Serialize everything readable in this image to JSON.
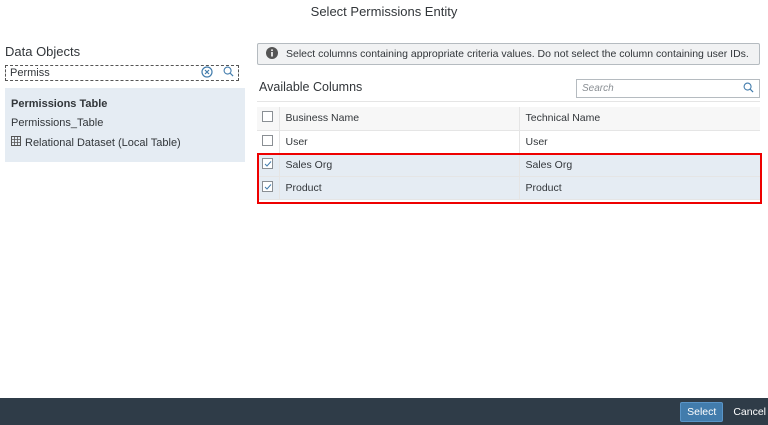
{
  "dialog": {
    "title": "Select Permissions Entity"
  },
  "left": {
    "heading": "Data Objects",
    "search_value": "Permiss",
    "result": {
      "title": "Permissions Table",
      "technical_name": "Permissions_Table",
      "type": "Relational Dataset (Local Table)",
      "type_icon": "table-icon"
    }
  },
  "info": {
    "icon": "info-icon",
    "message": "Select columns containing appropriate criteria values. Do not select the column containing user IDs."
  },
  "columns": {
    "heading": "Available Columns",
    "search_placeholder": "Search",
    "headers": [
      "Business Name",
      "Technical Name"
    ],
    "rows": [
      {
        "business": "User",
        "technical": "User",
        "checked": false
      },
      {
        "business": "Sales Org",
        "technical": "Sales Org",
        "checked": true
      },
      {
        "business": "Product",
        "technical": "Product",
        "checked": true
      }
    ]
  },
  "footer": {
    "select": "Select",
    "cancel": "Cancel"
  },
  "colors": {
    "accent": "#427cac",
    "footer": "#2f3c48",
    "selected_row": "#e5ecf3",
    "highlight": "#e00000"
  }
}
